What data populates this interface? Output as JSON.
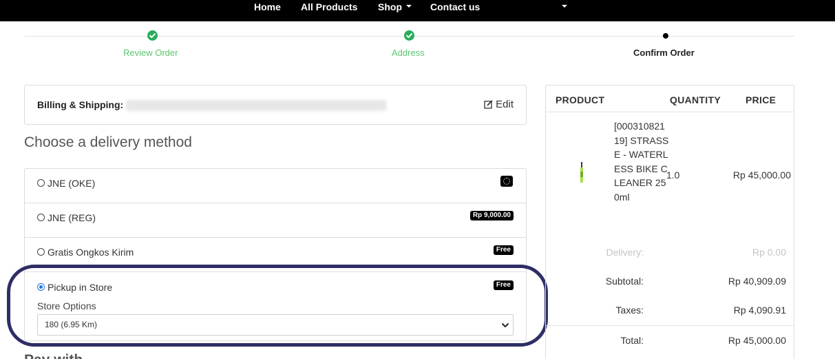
{
  "nav": {
    "items": [
      {
        "label": "Home"
      },
      {
        "label": "All Products"
      },
      {
        "label": "Shop",
        "dropdown": true
      },
      {
        "label": "Contact us"
      }
    ]
  },
  "progress": {
    "steps": [
      {
        "label": "Review Order",
        "status": "done"
      },
      {
        "label": "Address",
        "status": "done"
      },
      {
        "label": "Confirm Order",
        "status": "current"
      }
    ]
  },
  "billing": {
    "label": "Billing & Shipping:",
    "edit_label": "Edit"
  },
  "delivery": {
    "title": "Choose a delivery method",
    "methods": [
      {
        "name": "JNE (OKE)",
        "badge": "",
        "selected": false
      },
      {
        "name": "JNE (REG)",
        "badge": "Rp 9,000.00",
        "selected": false
      },
      {
        "name": "Gratis Ongkos Kirim",
        "badge": "Free",
        "selected": false
      },
      {
        "name": "Pickup in Store",
        "badge": "Free",
        "selected": true
      }
    ],
    "store_options_label": "Store Options",
    "store_selected": "180 (6.95 Km)"
  },
  "payment": {
    "title": "Pay with"
  },
  "summary": {
    "headers": {
      "product": "PRODUCT",
      "quantity": "QUANTITY",
      "price": "PRICE"
    },
    "product": {
      "name": "[00031082119] STRASSE - WATERLESS BIKE CLEANER 250ml",
      "quantity": "1.0",
      "price": "Rp 45,000.00"
    },
    "delivery_label": "Delivery:",
    "delivery_value": "Rp 0.00",
    "subtotal_label": "Subtotal:",
    "subtotal_value": "Rp 40,909.09",
    "taxes_label": "Taxes:",
    "taxes_value": "Rp 4,090.91",
    "total_label": "Total:",
    "total_value": "Rp 45,000.00"
  },
  "colors": {
    "nav_bg": "#000000",
    "step_done": "#27ae5a",
    "highlight_ring": "#2e2e66",
    "radio_selected": "#1a73e8"
  }
}
